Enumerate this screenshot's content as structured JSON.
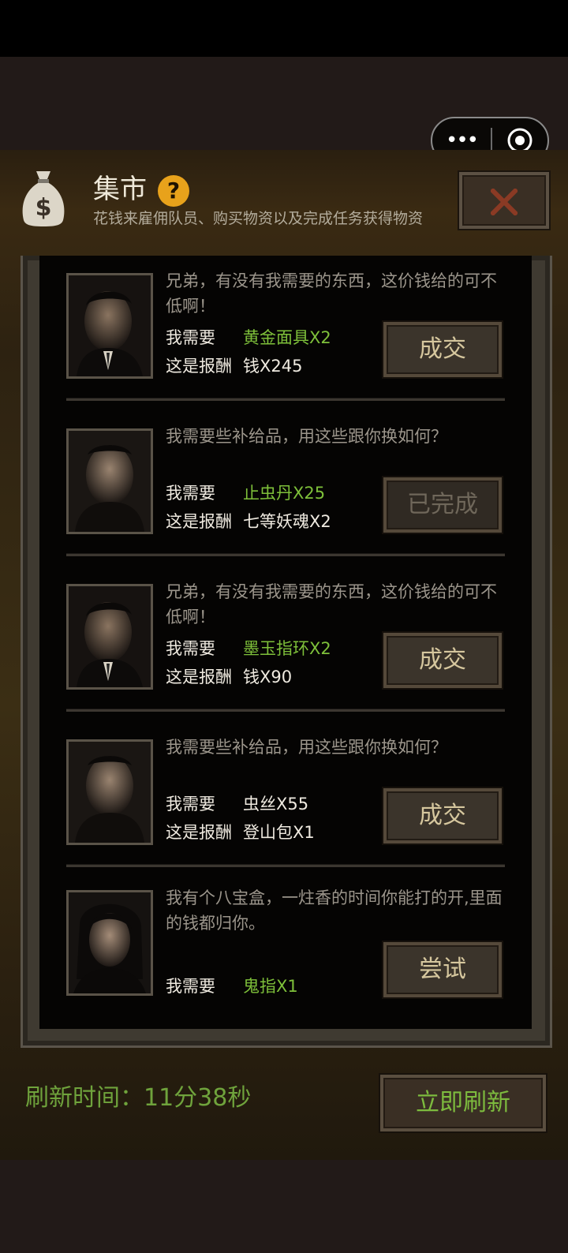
{
  "header": {
    "title": "集市",
    "subtitle": "花钱来雇佣队员、购买物资以及完成任务获得物资"
  },
  "items": [
    {
      "message": "兄弟，有没有我需要的东西，这价钱给的可不低啊！",
      "need_label": "我需要",
      "need_value": "黄金面具X2",
      "reward_label": "这是报酬",
      "reward_value": "钱X245",
      "button": "成交"
    },
    {
      "message": "我需要些补给品，用这些跟你换如何？",
      "need_label": "我需要",
      "need_value": "止虫丹X25",
      "reward_label": "这是报酬",
      "reward_value": "七等妖魂X2",
      "button": "已完成"
    },
    {
      "message": "兄弟，有没有我需要的东西，这价钱给的可不低啊！",
      "need_label": "我需要",
      "need_value": "墨玉指环X2",
      "reward_label": "这是报酬",
      "reward_value": "钱X90",
      "button": "成交"
    },
    {
      "message": "我需要些补给品，用这些跟你换如何？",
      "need_label": "我需要",
      "need_value": "虫丝X55",
      "reward_label": "这是报酬",
      "reward_value": "登山包X1",
      "button": "成交"
    },
    {
      "message": "我有个八宝盒，一炷香的时间你能打的开,里面的钱都归你。",
      "need_label": "我需要",
      "need_value": "鬼指X1",
      "button": "尝试"
    }
  ],
  "footer": {
    "refresh_time_label": "刷新时间：",
    "refresh_time_value": "11分38秒",
    "refresh_button": "立即刷新"
  },
  "colors": {
    "highlight_green": "#7ec03a",
    "button_text": "#d6c79e",
    "help_orange": "#e8a21b",
    "close_red": "#8a3a24"
  },
  "icons": [
    "more-icon",
    "target-icon",
    "money-bag-icon",
    "help-icon",
    "close-icon"
  ]
}
